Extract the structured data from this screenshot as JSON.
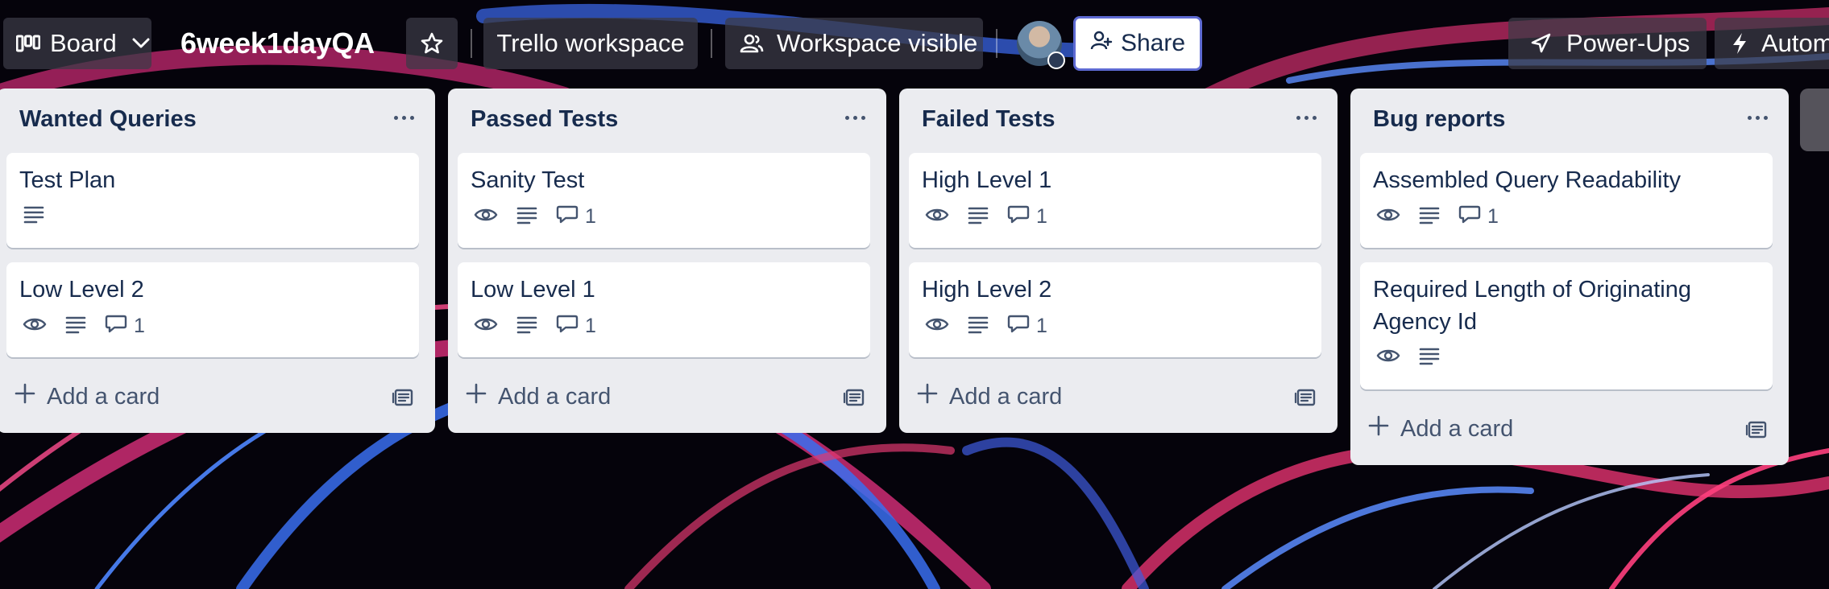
{
  "header": {
    "view_switch_label": "Board",
    "board_title": "6week1dayQA",
    "workspace_label": "Trello workspace",
    "visibility_label": "Workspace visible",
    "share_label": "Share",
    "powerups_label": "Power-Ups",
    "automation_label": "Autom"
  },
  "lists": [
    {
      "title": "Wanted Queries",
      "add_label": "Add a card",
      "cards": [
        {
          "title": "Test Plan",
          "comments": ""
        },
        {
          "title": "Low Level 2",
          "comments": "1"
        }
      ]
    },
    {
      "title": "Passed Tests",
      "add_label": "Add a card",
      "cards": [
        {
          "title": "Sanity Test",
          "comments": "1"
        },
        {
          "title": "Low Level 1",
          "comments": "1"
        }
      ]
    },
    {
      "title": "Failed Tests",
      "add_label": "Add a card",
      "cards": [
        {
          "title": "High Level 1",
          "comments": "1"
        },
        {
          "title": "High Level 2",
          "comments": "1"
        }
      ]
    },
    {
      "title": "Bug reports",
      "add_label": "Add a card",
      "cards": [
        {
          "title": "Assembled Query Readability",
          "comments": "1"
        },
        {
          "title": "Required Length of Originating Agency Id",
          "comments": ""
        }
      ]
    }
  ],
  "icons": {
    "board_view": "board-icon",
    "chevron": "chevron-down-icon",
    "star": "star-icon",
    "visibility": "people-icon",
    "share": "add-person-icon",
    "powerups": "rocket-icon",
    "automation": "lightning-icon",
    "watch": "eye-icon",
    "description": "description-icon",
    "comment": "comment-icon",
    "add": "plus-icon",
    "template": "card-template-icon"
  }
}
